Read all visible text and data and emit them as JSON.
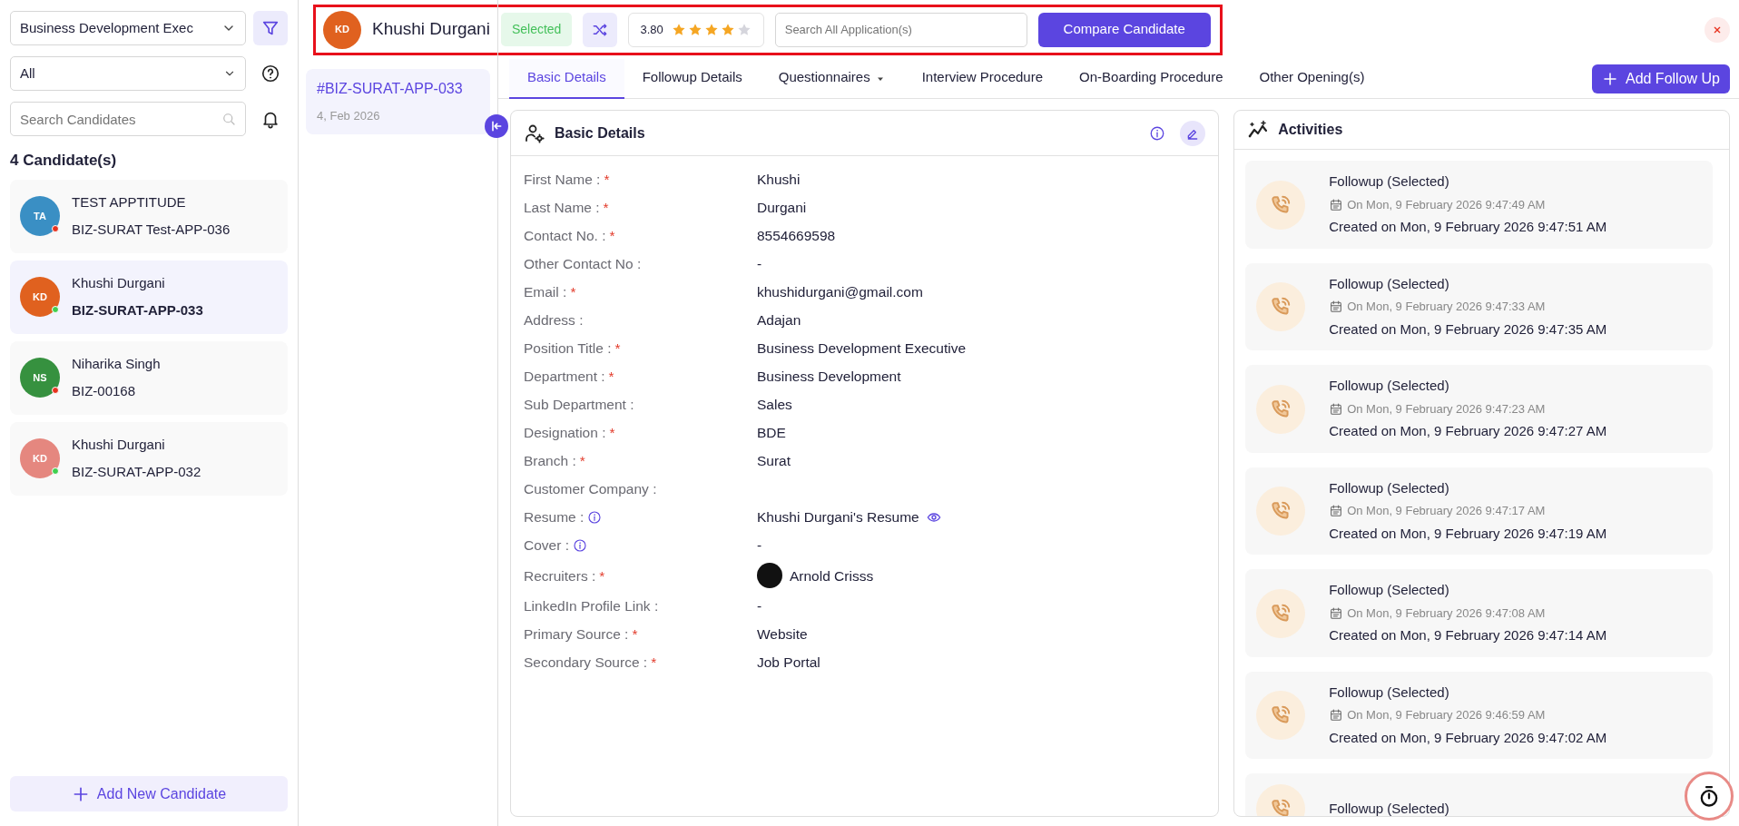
{
  "sidebar": {
    "position_select": "Business Development Exec",
    "status_select": "All",
    "search": {
      "placeholder": "Search Candidates"
    },
    "count": "4 Candidate(s)",
    "candidates": [
      {
        "initials": "TA",
        "avatar": {
          "color": "#3a8fc4"
        },
        "color": "#e8321e",
        "name": "TEST APPTITUDE",
        "code": "BIZ-SURAT Test-APP-036",
        "selected": false
      },
      {
        "initials": "KD",
        "avatar": {
          "color": "#e0611f"
        },
        "color": "#3fcf4f",
        "name": "Khushi Durgani",
        "code": "BIZ-SURAT-APP-033",
        "selected": true
      },
      {
        "initials": "NS",
        "avatar": {
          "color": "#36913f"
        },
        "color": "#e8321e",
        "name": "Niharika Singh",
        "code": "BIZ-00168",
        "selected": false
      },
      {
        "initials": "KD",
        "avatar": {
          "color": "#e5877f"
        },
        "color": "#3fcf4f",
        "name": "Khushi Durgani",
        "code": "BIZ-SURAT-APP-032",
        "selected": false
      }
    ],
    "add_button": "Add New Candidate"
  },
  "applications": [
    {
      "code": "#BIZ-SURAT-APP-033",
      "date": "4, Feb 2026",
      "selected": true
    }
  ],
  "header": {
    "highlighted": true,
    "initials": "KD",
    "name": "Khushi Durgani",
    "status": "Selected",
    "rating": "3.80",
    "stars": 4,
    "search": {
      "placeholder": "Search All Application(s)"
    },
    "compare_button": "Compare Candidate"
  },
  "tabs": [
    {
      "label": "Basic Details",
      "selected": true,
      "dropdown": false
    },
    {
      "label": "Followup Details",
      "selected": false,
      "dropdown": false
    },
    {
      "label": "Questionnaires",
      "selected": false,
      "dropdown": true
    },
    {
      "label": "Interview Procedure",
      "selected": false,
      "dropdown": false
    },
    {
      "label": "On-Boarding Procedure",
      "selected": false,
      "dropdown": false
    },
    {
      "label": "Other Opening(s)",
      "selected": false,
      "dropdown": false
    }
  ],
  "add_follow_up": "Add Follow Up",
  "basic_details": {
    "title": "Basic Details",
    "required_mark": "*",
    "fields": [
      {
        "label": "First Name :",
        "required": true,
        "info": false,
        "kind": "text",
        "value": "Khushi"
      },
      {
        "label": "Last Name :",
        "required": true,
        "info": false,
        "kind": "text",
        "value": "Durgani"
      },
      {
        "label": "Contact No. :",
        "required": true,
        "info": false,
        "kind": "text",
        "value": "8554669598"
      },
      {
        "label": "Other Contact No :",
        "required": false,
        "info": false,
        "kind": "text",
        "value": "-"
      },
      {
        "label": "Email :",
        "required": true,
        "info": false,
        "kind": "text",
        "value": "khushidurgani@gmail.com"
      },
      {
        "label": "Address :",
        "required": false,
        "info": false,
        "kind": "text",
        "value": "Adajan"
      },
      {
        "label": "Position Title :",
        "required": true,
        "info": false,
        "kind": "text",
        "value": "Business Development Executive"
      },
      {
        "label": "Department :",
        "required": true,
        "info": false,
        "kind": "text",
        "value": "Business Development"
      },
      {
        "label": "Sub Department :",
        "required": false,
        "info": false,
        "kind": "text",
        "value": "Sales"
      },
      {
        "label": "Designation :",
        "required": true,
        "info": false,
        "kind": "text",
        "value": "BDE"
      },
      {
        "label": "Branch :",
        "required": true,
        "info": false,
        "kind": "text",
        "value": "Surat"
      },
      {
        "label": "Customer Company :",
        "required": false,
        "info": false,
        "kind": "text"
      },
      {
        "label": "Resume :",
        "required": false,
        "info": true,
        "kind": "file",
        "value": "Khushi Durgani's Resume"
      },
      {
        "label": "Cover :",
        "required": false,
        "info": true,
        "kind": "text",
        "value": "-"
      },
      {
        "label": "Recruiters :",
        "required": true,
        "info": false,
        "kind": "person",
        "value": "Arnold Crisss"
      },
      {
        "label": "LinkedIn Profile Link :",
        "required": false,
        "info": false,
        "kind": "text",
        "value": "-"
      },
      {
        "label": "Primary Source :",
        "required": true,
        "info": false,
        "kind": "text",
        "value": "Website"
      },
      {
        "label": "Secondary Source :",
        "required": true,
        "info": false,
        "kind": "text",
        "value": "Job Portal"
      }
    ]
  },
  "activities": {
    "title": "Activities",
    "items": [
      {
        "title": "Followup (Selected)",
        "scheduled": "On Mon, 9 February 2026 9:47:49 AM",
        "created": "Created on Mon, 9 February 2026 9:47:51 AM"
      },
      {
        "title": "Followup (Selected)",
        "scheduled": "On Mon, 9 February 2026 9:47:33 AM",
        "created": "Created on Mon, 9 February 2026 9:47:35 AM"
      },
      {
        "title": "Followup (Selected)",
        "scheduled": "On Mon, 9 February 2026 9:47:23 AM",
        "created": "Created on Mon, 9 February 2026 9:47:27 AM"
      },
      {
        "title": "Followup (Selected)",
        "scheduled": "On Mon, 9 February 2026 9:47:17 AM",
        "created": "Created on Mon, 9 February 2026 9:47:19 AM"
      },
      {
        "title": "Followup (Selected)",
        "scheduled": "On Mon, 9 February 2026 9:47:08 AM",
        "created": "Created on Mon, 9 February 2026 9:47:14 AM"
      },
      {
        "title": "Followup (Selected)",
        "scheduled": "On Mon, 9 February 2026 9:46:59 AM",
        "created": "Created on Mon, 9 February 2026 9:47:02 AM"
      },
      {
        "title": "Followup (Selected)"
      }
    ]
  }
}
